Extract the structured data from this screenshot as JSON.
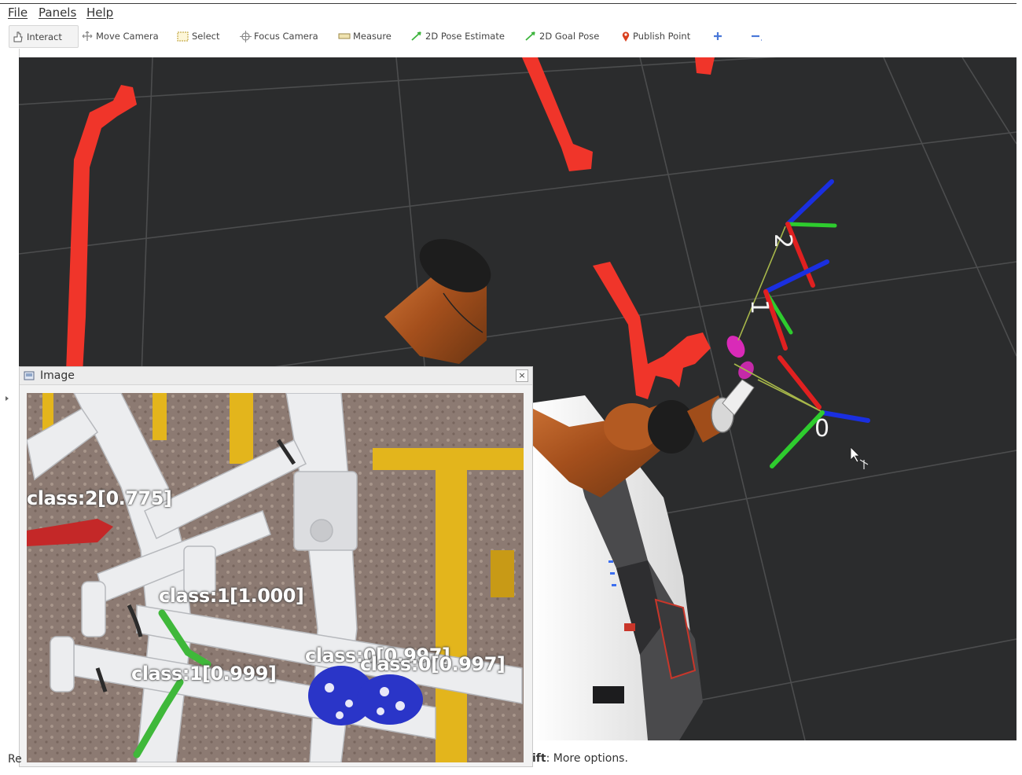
{
  "menubar": {
    "file": "File",
    "panels": "Panels",
    "help": "Help"
  },
  "toolbar": {
    "interact": "Interact",
    "move_camera": "Move Camera",
    "select": "Select",
    "focus_camera": "Focus Camera",
    "measure": "Measure",
    "pose_estimate": "2D Pose Estimate",
    "goal_pose": "2D Goal Pose",
    "publish_point": "Publish Point"
  },
  "viewport": {
    "frame_labels": [
      "2",
      "1",
      "0"
    ]
  },
  "image_panel": {
    "title": "Image",
    "close": "×",
    "detections": [
      "class:2[0.775]",
      "class:1[1.000]",
      "class:1[0.999]",
      "class:0[0.997]",
      "class:0[0.997]"
    ]
  },
  "statusbar": {
    "left": "Re",
    "key": "ift",
    "hint": ": More options."
  },
  "colors": {
    "viewport_bg": "#2b2c2d",
    "grid": "#4a4b4c",
    "obstacles": "#f0352a",
    "robot_arm": "#b3561f",
    "axis_x": "#e02020",
    "axis_y": "#2ecc2e",
    "axis_z": "#1a2fe0"
  }
}
